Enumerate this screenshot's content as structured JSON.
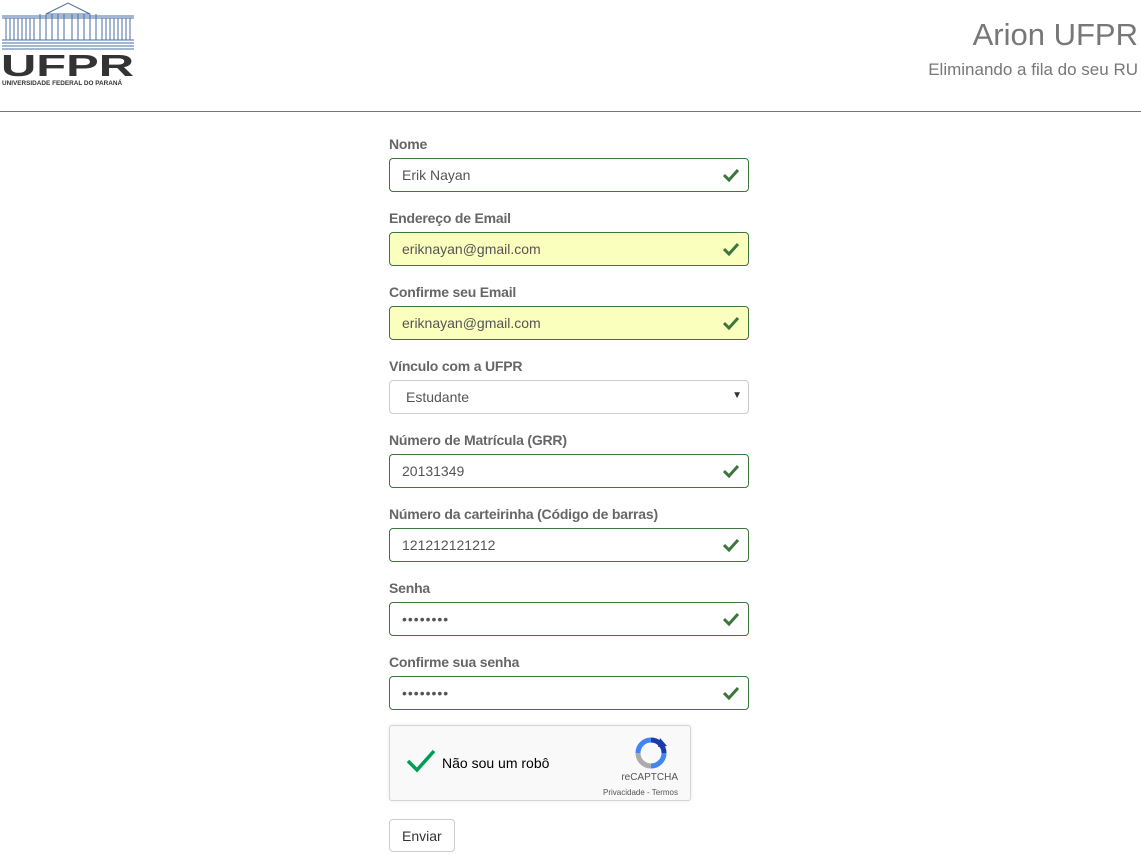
{
  "header": {
    "logo_text": "UFPR",
    "logo_caption": "UNIVERSIDADE FEDERAL DO PARANÁ",
    "title": "Arion UFPR",
    "tagline": "Eliminando a fila do seu RU"
  },
  "form": {
    "nome": {
      "label": "Nome",
      "value": "Erik Nayan"
    },
    "email": {
      "label": "Endereço de Email",
      "value": "eriknayan@gmail.com"
    },
    "email_confirm": {
      "label": "Confirme seu Email",
      "value": "eriknayan@gmail.com"
    },
    "vinculo": {
      "label": "Vínculo com a UFPR",
      "selected": "Estudante"
    },
    "matricula": {
      "label": "Número de Matrícula (GRR)",
      "value": "20131349"
    },
    "carteirinha": {
      "label": "Número da carteirinha (Código de barras)",
      "value": "121212121212"
    },
    "senha": {
      "label": "Senha",
      "value": "••••••••"
    },
    "senha_confirm": {
      "label": "Confirme sua senha",
      "value": "••••••••"
    },
    "submit_label": "Enviar"
  },
  "recaptcha": {
    "label": "Não sou um robô",
    "checked": true,
    "brand": "reCAPTCHA",
    "links": "Privacidade - Termos"
  },
  "colors": {
    "valid_border": "#3c763d",
    "autofill_bg": "#faffbd",
    "captcha_check": "#009e55"
  }
}
